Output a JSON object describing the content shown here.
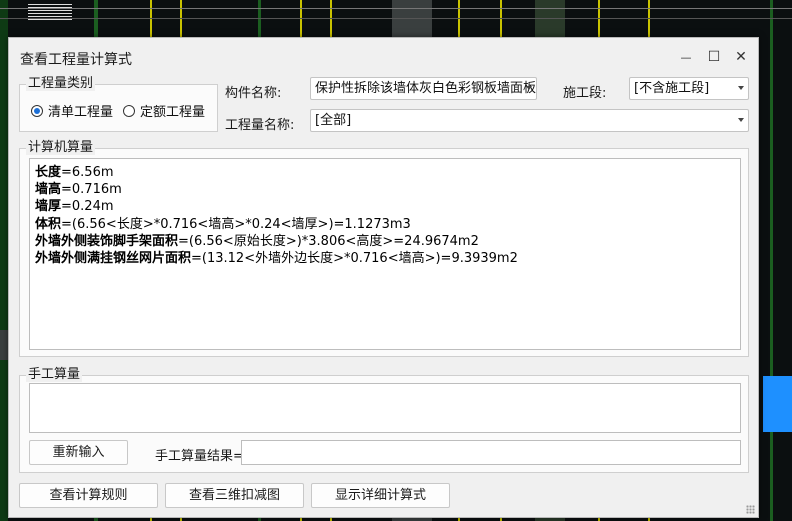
{
  "window": {
    "title": "查看工程量计算式",
    "minimize_glyph": "—",
    "maximize_glyph": "☐",
    "close_glyph": "✕"
  },
  "category": {
    "legend": "工程量类别",
    "options": [
      {
        "label": "清单工程量",
        "selected": true
      },
      {
        "label": "定额工程量",
        "selected": false
      }
    ]
  },
  "filters": {
    "component_label": "构件名称:",
    "component_value": "保护性拆除该墙体灰白色彩钢板墙面板",
    "section_label": "施工段:",
    "section_value": "[不含施工段]",
    "quantity_label": "工程量名称:",
    "quantity_value": "[全部]"
  },
  "computer_calc": {
    "legend": "计算机算量",
    "lines": [
      {
        "key": "长度",
        "expr": "=6.56m"
      },
      {
        "key": "墙高",
        "expr": "=0.716m"
      },
      {
        "key": "墙厚",
        "expr": "=0.24m"
      },
      {
        "key": "体积",
        "expr": "=(6.56<长度>*0.716<墙高>*0.24<墙厚>)=1.1273m3"
      },
      {
        "key": "外墙外侧装饰脚手架面积",
        "expr": "=(6.56<原始长度>)*3.806<高度>=24.9674m2"
      },
      {
        "key": "外墙外侧满挂钢丝网片面积",
        "expr": "=(13.12<外墙外边长度>*0.716<墙高>)=9.3939m2"
      }
    ]
  },
  "manual_calc": {
    "legend": "手工算量",
    "reenter_button": "重新输入",
    "result_label": "手工算量结果=",
    "result_value": ""
  },
  "footer": {
    "view_rules_button": "查看计算规则",
    "view_3d_button": "查看三维扣减图",
    "show_detail_button": "显示详细计算式"
  },
  "colors": {
    "dialog_bg": "#f0f0f0",
    "radio_accent": "#1c6fd6",
    "cad_yellow": "#d8d200",
    "cad_blue": "#1e90ff"
  }
}
